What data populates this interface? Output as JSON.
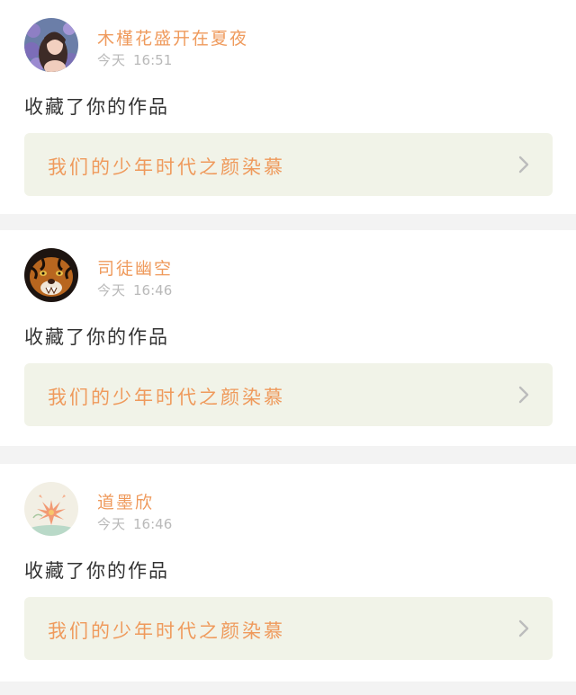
{
  "feed": {
    "items": [
      {
        "username": "木槿花盛开在夏夜",
        "time_day": "今天",
        "time_clock": "16:51",
        "action": "收藏了你的作品",
        "work_title": "我们的少年时代之颜染慕",
        "avatar_icon": "avatar-flower-girl-icon"
      },
      {
        "username": "司徒幽空",
        "time_day": "今天",
        "time_clock": "16:46",
        "action": "收藏了你的作品",
        "work_title": "我们的少年时代之颜染慕",
        "avatar_icon": "avatar-tiger-icon"
      },
      {
        "username": "道墨欣",
        "time_day": "今天",
        "time_clock": "16:46",
        "action": "收藏了你的作品",
        "work_title": "我们的少年时代之颜染慕",
        "avatar_icon": "avatar-lotus-icon"
      }
    ]
  },
  "colors": {
    "accent": "#ef9a5c",
    "link_background": "#f1f3e8",
    "separator": "#f3f3f3",
    "muted_text": "#b9b9b9"
  }
}
